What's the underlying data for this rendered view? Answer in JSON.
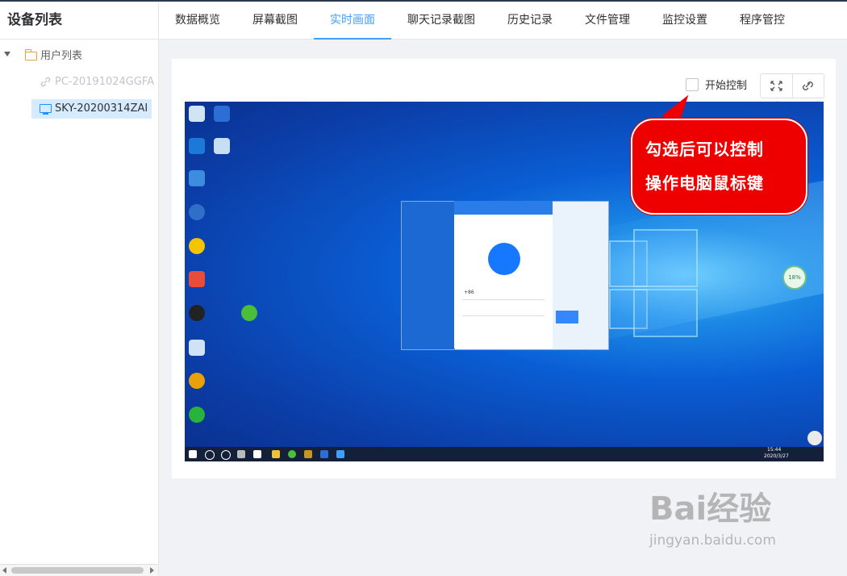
{
  "sidebar": {
    "title": "设备列表",
    "tree": {
      "root_label": "用户列表",
      "devices": [
        {
          "label": "PC-20191024GGFA",
          "status": "offline"
        },
        {
          "label": "SKY-20200314ZAI",
          "status": "online",
          "selected": true
        }
      ]
    }
  },
  "tabs": [
    {
      "label": "数据概览"
    },
    {
      "label": "屏幕截图"
    },
    {
      "label": "实时画面",
      "active": true
    },
    {
      "label": "聊天记录截图"
    },
    {
      "label": "历史记录"
    },
    {
      "label": "文件管理"
    },
    {
      "label": "监控设置"
    },
    {
      "label": "程序管控"
    }
  ],
  "control": {
    "checkbox_label": "开始控制",
    "checked": false,
    "fullscreen_icon": "fullscreen-icon",
    "disconnect_icon": "unlink-icon"
  },
  "callout": {
    "line1": "勾选后可以控制",
    "line2": "操作电脑鼠标键"
  },
  "remote_screen": {
    "taskbar_time": "15:44",
    "taskbar_date": "2020/3/27",
    "login_app": {
      "phone_prefix": "+86",
      "monitor_badge": "18%"
    }
  },
  "watermark": {
    "brand": "Bai经验",
    "url": "jingyan.baidu.com"
  },
  "colors": {
    "accent": "#409eff",
    "callout": "#ee0000",
    "selected_row": "#d6ebff"
  }
}
